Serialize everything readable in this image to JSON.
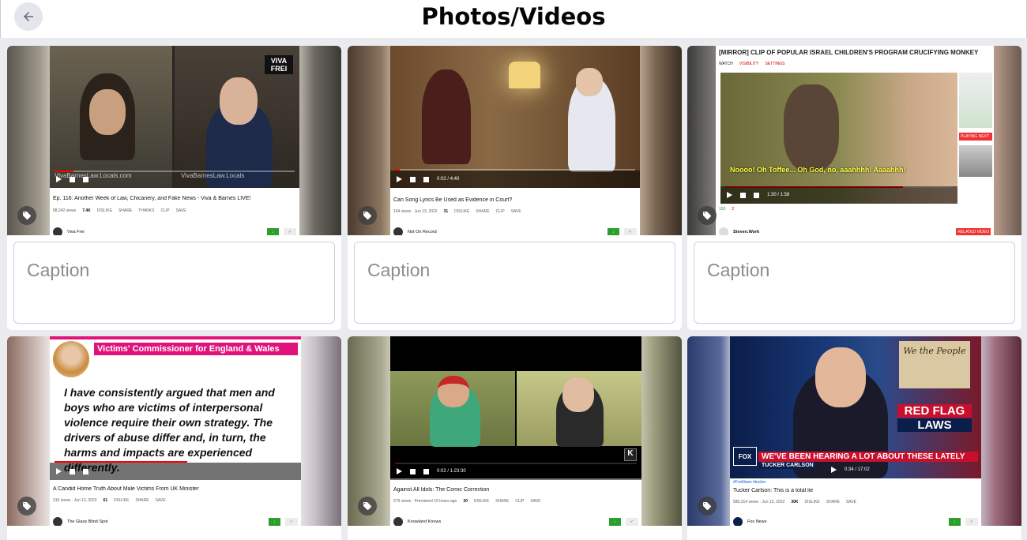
{
  "header": {
    "title": "Photos/Videos"
  },
  "caption_placeholder": "Caption",
  "cards": [
    {
      "title": "Ep. 116: Another Week of Law, Chicanery, and Fake News - Viva & Barnes LIVE!",
      "views": "88,242 views",
      "likes": "7.4K",
      "actions": [
        "DISLIKE",
        "SHARE",
        "THANKS",
        "CLIP",
        "SAVE"
      ],
      "channel": "Viva Frei",
      "overlay": "VIVA FREI",
      "wm_left": "VivaBarnesLaw.Locals.com",
      "wm_right": "VivaBarnesLaw.Locals"
    },
    {
      "title": "Can Song Lyrics Be Used as Evidence in Court?",
      "views": "194 views · Jun 13, 2022",
      "likes": "31",
      "actions": [
        "DISLIKE",
        "SHARE",
        "CLIP",
        "SAVE"
      ],
      "channel": "Not On Record",
      "time": "0:02 / 4:40"
    },
    {
      "title": "[MIRROR] CLIP OF POPULAR ISRAEL CHILDREN'S PROGRAM CRUCIFYING MONKEY",
      "tabs": [
        "WATCH",
        "VISIBILITY",
        "SETTINGS"
      ],
      "subtitle": "Noooo! Oh Toffee... Oh God, no, aaahhhh! Aaaahhh!",
      "time": "1:30 / 1:58",
      "channel": "Steven.Work",
      "side_labels": [
        "PLAYING NEXT",
        "RELATED VIDEO"
      ],
      "likes": "153",
      "dislikes": "2"
    },
    {
      "title": "A Candid Home Truth About Male Victims From UK Minister",
      "views": "319 views · Jun 13, 2022",
      "likes": "61",
      "actions": [
        "DISLIKE",
        "SHARE",
        "SAVE"
      ],
      "channel": "The Glass Blind Spot",
      "banner": "Victims' Commissioner for England & Wales",
      "quote": "I have consistently argued that men and boys who are victims of interpersonal violence require their own strategy. The drivers of abuse differ and, in turn, the harms and impacts are experienced differently."
    },
    {
      "title": "Against All Idols: The Comic Correction",
      "views": "279 views · Premiered 19 hours ago",
      "likes": "30",
      "actions": [
        "DISLIKE",
        "SHARE",
        "CLIP",
        "SAVE"
      ],
      "channel": "Knowland Knows",
      "time": "0:02 / 1:23:30"
    },
    {
      "title": "Tucker Carlson: This is a total lie",
      "hashtags": "#FoxNews #tucker",
      "views": "580,314 views · Jun 13, 2022",
      "likes": "30K",
      "actions": [
        "DISLIKE",
        "SHARE",
        "SAVE"
      ],
      "channel": "Fox News",
      "graphic_line1": "RED FLAG",
      "graphic_line2": "LAWS",
      "chyron": "WE'VE BEEN HEARING A LOT ABOUT THESE LATELY",
      "chyron_name": "TUCKER CARLSON",
      "time": "0:34 / 17:02",
      "document": "We the People"
    }
  ],
  "colors": {
    "accent_green": "#2b9e2b",
    "caption_border": "#ccd0d5",
    "fox_red": "#c8102e"
  }
}
